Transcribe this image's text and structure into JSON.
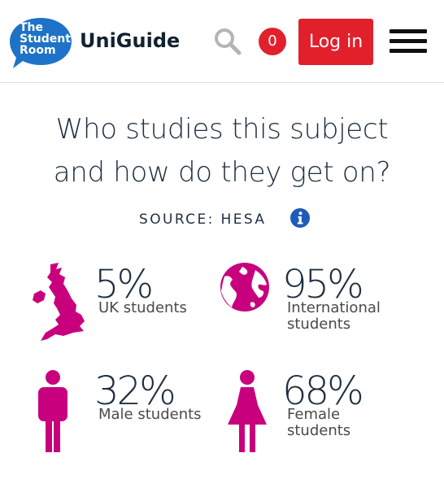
{
  "header": {
    "logo_lines": [
      "The",
      "Student",
      "Room"
    ],
    "brand": "UniGuide",
    "notification_count": "0",
    "login_label": "Log in",
    "icons": [
      "search-icon",
      "menu-icon"
    ]
  },
  "section": {
    "heading_line1": "Who studies this subject",
    "heading_line2": "and how do they get on?",
    "source": "SOURCE: HESA",
    "source_icon": "info-icon"
  },
  "stats": {
    "uk": {
      "value": "5%",
      "label": "UK students",
      "icon": "uk-map-icon"
    },
    "international": {
      "value": "95%",
      "label_line1": "International",
      "label_line2": "students",
      "icon": "globe-icon"
    },
    "male": {
      "value": "32%",
      "label": "Male students",
      "icon": "male-icon"
    },
    "female": {
      "value": "68%",
      "label_line1": "Female",
      "label_line2": "students",
      "icon": "female-icon"
    }
  },
  "colors": {
    "accent_red": "#e2202c",
    "logo_blue": "#1e73c8",
    "stat_magenta": "#c8007e",
    "text_dark": "#1f2f3f"
  }
}
